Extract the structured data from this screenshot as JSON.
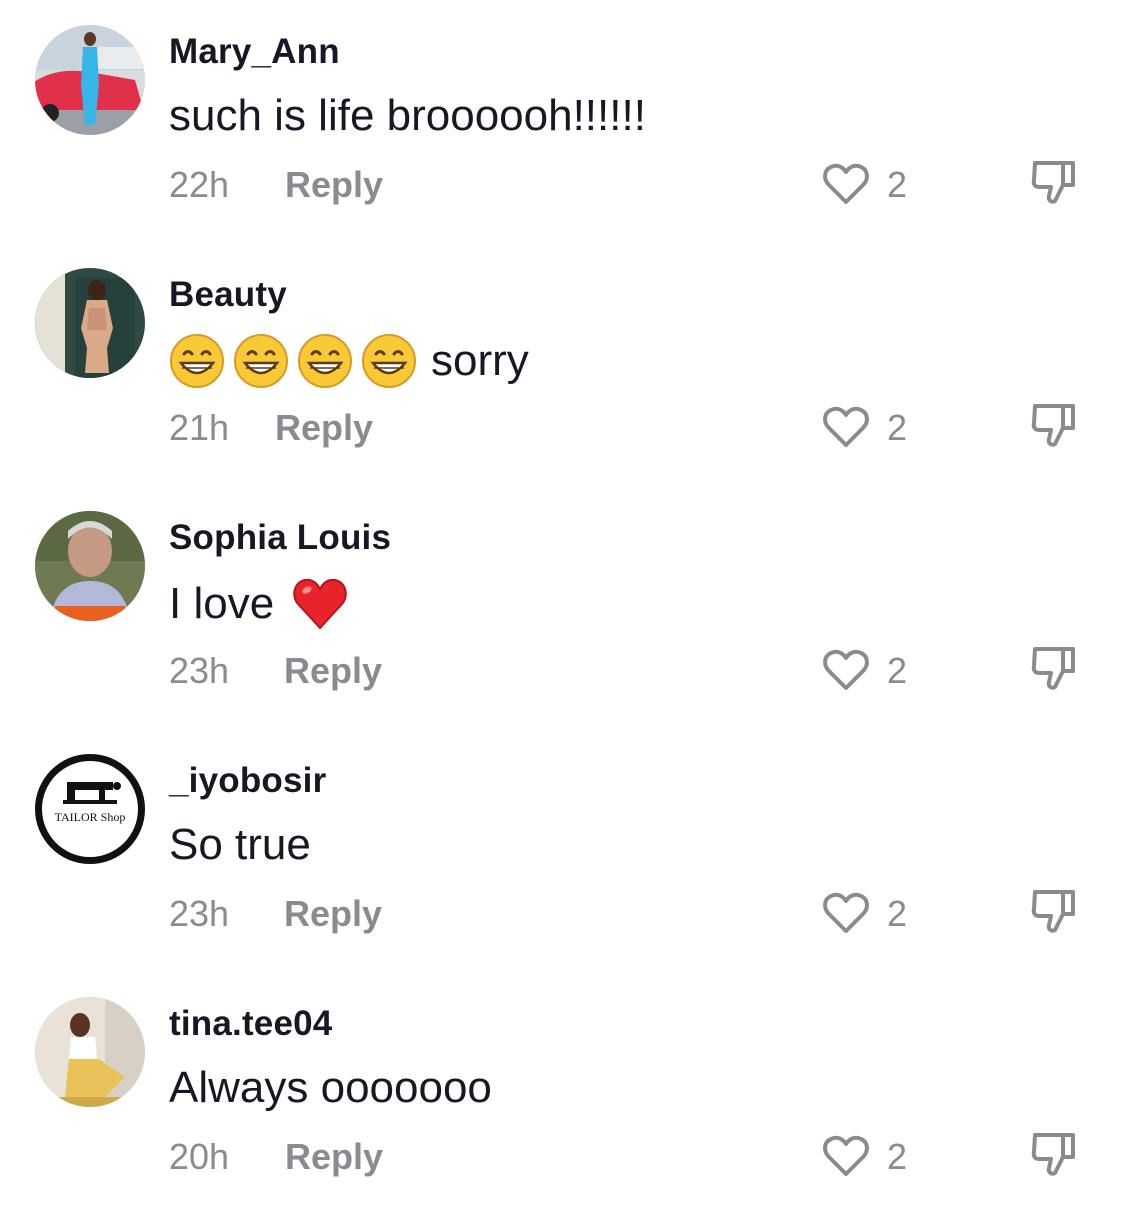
{
  "comments": [
    {
      "username": "Mary_Ann",
      "text": "such is life broooooh!!!!!!",
      "emojis": [],
      "time": "22h",
      "reply_label": "Reply",
      "likes": "2",
      "avatar": "avatar-woman-by-red-car"
    },
    {
      "username": "Beauty",
      "text": "sorry",
      "emojis": [
        "grinning-face",
        "grinning-face",
        "grinning-face",
        "grinning-face"
      ],
      "time": "21h",
      "reply_label": "Reply",
      "likes": "2",
      "avatar": "avatar-woman-by-gate"
    },
    {
      "username": "Sophia Louis",
      "text": "I love",
      "emojis_after": [
        "red-heart"
      ],
      "time": "23h",
      "reply_label": "Reply",
      "likes": "2",
      "avatar": "avatar-woman-portrait"
    },
    {
      "username": "_iyobosir",
      "text": "So true",
      "emojis": [],
      "time": "23h",
      "reply_label": "Reply",
      "likes": "2",
      "avatar": "avatar-tailor-shop-logo",
      "avatar_logo_text": "TAILOR Shop"
    },
    {
      "username": "tina.tee04",
      "text": "Always ooooooo",
      "emojis": [],
      "time": "20h",
      "reply_label": "Reply",
      "likes": "2",
      "avatar": "avatar-woman-sitting"
    }
  ],
  "colors": {
    "text_primary": "#161823",
    "text_secondary": "#8a8b91",
    "background": "#ffffff"
  },
  "icons": {
    "like": "heart-outline-icon",
    "dislike": "thumbs-down-icon"
  }
}
